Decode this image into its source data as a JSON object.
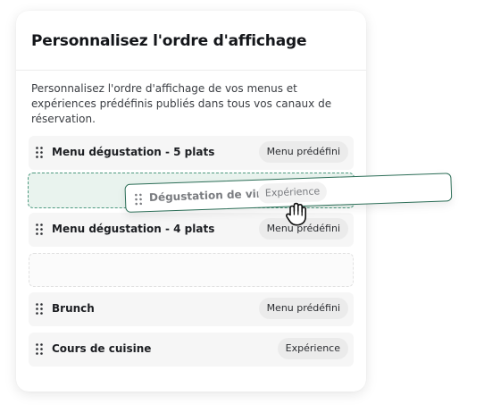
{
  "card": {
    "title": "Personnalisez l'ordre d'affichage",
    "description": "Personnalisez l'ordre d'affichage de vos menus et expériences prédéfinis publiés dans tous vos canaux de réservation."
  },
  "list": {
    "items": [
      {
        "label": "Menu dégustation - 5 plats",
        "badge": "Menu prédéfini"
      },
      {
        "label": "Menu dégustation - 4 plats",
        "badge": "Menu prédéfini"
      },
      {
        "label": "Brunch",
        "badge": "Menu prédéfini"
      },
      {
        "label": "Cours de cuisine",
        "badge": "Expérience"
      }
    ],
    "dragged_item": {
      "label": "Dégustation de vins",
      "badge": "Expérience"
    }
  },
  "colors": {
    "accent": "#2c6e57",
    "drop_target_fill": "#e9f3ee",
    "row_fill": "#f6f6f6",
    "badge_fill": "#ebebeb"
  },
  "icons": {
    "handle": "drag-handle-icon",
    "cursor": "grab-hand-cursor-icon"
  }
}
